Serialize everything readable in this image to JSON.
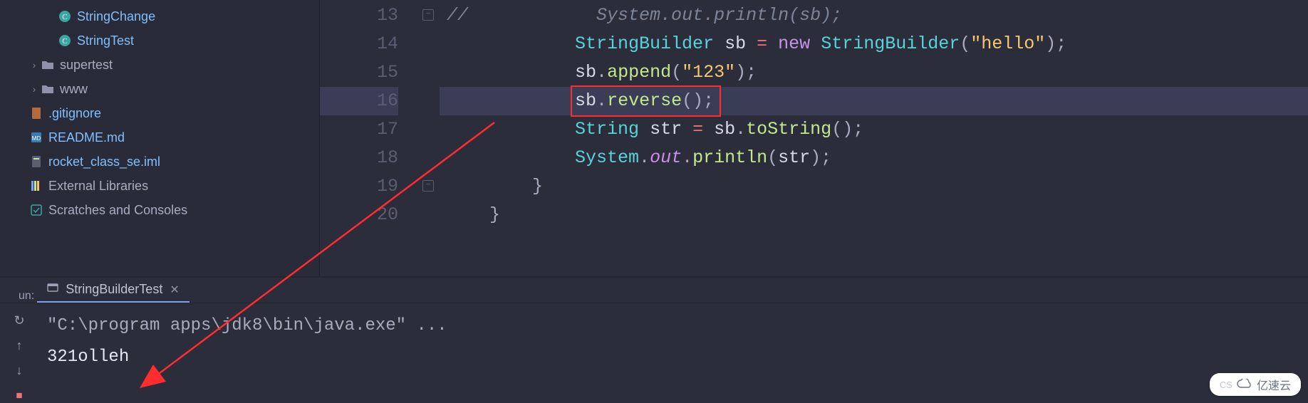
{
  "sidebar": {
    "items": [
      {
        "label": "StringChange",
        "icon": "class-circle",
        "indent": 2,
        "chev": ""
      },
      {
        "label": "StringTest",
        "icon": "class-circle",
        "indent": 2,
        "chev": ""
      },
      {
        "label": "supertest",
        "icon": "folder",
        "indent": 1,
        "chev": "›"
      },
      {
        "label": "www",
        "icon": "folder",
        "indent": 1,
        "chev": "›"
      },
      {
        "label": ".gitignore",
        "icon": "git-file",
        "indent": 0,
        "chev": ""
      },
      {
        "label": "README.md",
        "icon": "md-file",
        "indent": 0,
        "chev": ""
      },
      {
        "label": "rocket_class_se.iml",
        "icon": "iml-file",
        "indent": 0,
        "chev": ""
      },
      {
        "label": "External Libraries",
        "icon": "library",
        "indent": 0,
        "chev": ""
      },
      {
        "label": "Scratches and Consoles",
        "icon": "scratch",
        "indent": 0,
        "chev": ""
      }
    ]
  },
  "editor": {
    "lines": [
      {
        "n": "13",
        "tokens": [
          {
            "t": "//",
            "c": "c-comment"
          },
          {
            "t": "            System.out.println(sb);",
            "c": "c-comment"
          }
        ]
      },
      {
        "n": "14",
        "tokens": [
          {
            "t": "            ",
            "c": ""
          },
          {
            "t": "StringBuilder",
            "c": "c-type"
          },
          {
            "t": " ",
            "c": ""
          },
          {
            "t": "sb",
            "c": "c-ident"
          },
          {
            "t": " ",
            "c": ""
          },
          {
            "t": "=",
            "c": "c-op"
          },
          {
            "t": " ",
            "c": ""
          },
          {
            "t": "new",
            "c": "c-new"
          },
          {
            "t": " ",
            "c": ""
          },
          {
            "t": "StringBuilder",
            "c": "c-type"
          },
          {
            "t": "(",
            "c": "c-punct"
          },
          {
            "t": "\"hello\"",
            "c": "c-str"
          },
          {
            "t": ")",
            "c": "c-punct"
          },
          {
            "t": ";",
            "c": "c-punct"
          }
        ]
      },
      {
        "n": "15",
        "tokens": [
          {
            "t": "            ",
            "c": ""
          },
          {
            "t": "sb",
            "c": "c-ident"
          },
          {
            "t": ".",
            "c": "c-punct"
          },
          {
            "t": "append",
            "c": "c-method"
          },
          {
            "t": "(",
            "c": "c-punct"
          },
          {
            "t": "\"123\"",
            "c": "c-str"
          },
          {
            "t": ")",
            "c": "c-punct"
          },
          {
            "t": ";",
            "c": "c-punct"
          }
        ]
      },
      {
        "n": "16",
        "tokens": [
          {
            "t": "            ",
            "c": ""
          },
          {
            "t": "sb",
            "c": "c-ident"
          },
          {
            "t": ".",
            "c": "c-punct"
          },
          {
            "t": "reverse",
            "c": "c-method"
          },
          {
            "t": "()",
            "c": "c-punct"
          },
          {
            "t": ";",
            "c": "c-punct"
          }
        ],
        "highlight": true
      },
      {
        "n": "17",
        "tokens": [
          {
            "t": "            ",
            "c": ""
          },
          {
            "t": "String",
            "c": "c-type"
          },
          {
            "t": " ",
            "c": ""
          },
          {
            "t": "str",
            "c": "c-ident"
          },
          {
            "t": " ",
            "c": ""
          },
          {
            "t": "=",
            "c": "c-op"
          },
          {
            "t": " ",
            "c": ""
          },
          {
            "t": "sb",
            "c": "c-ident"
          },
          {
            "t": ".",
            "c": "c-punct"
          },
          {
            "t": "toString",
            "c": "c-method"
          },
          {
            "t": "()",
            "c": "c-punct"
          },
          {
            "t": ";",
            "c": "c-punct"
          }
        ]
      },
      {
        "n": "18",
        "tokens": [
          {
            "t": "            ",
            "c": ""
          },
          {
            "t": "System",
            "c": "c-type"
          },
          {
            "t": ".",
            "c": "c-punct"
          },
          {
            "t": "out",
            "c": "c-field"
          },
          {
            "t": ".",
            "c": "c-punct"
          },
          {
            "t": "println",
            "c": "c-method"
          },
          {
            "t": "(",
            "c": "c-punct"
          },
          {
            "t": "str",
            "c": "c-ident"
          },
          {
            "t": ")",
            "c": "c-punct"
          },
          {
            "t": ";",
            "c": "c-punct"
          }
        ]
      },
      {
        "n": "19",
        "tokens": [
          {
            "t": "        ",
            "c": ""
          },
          {
            "t": "}",
            "c": "c-punct"
          }
        ]
      },
      {
        "n": "20",
        "tokens": [
          {
            "t": "    ",
            "c": ""
          },
          {
            "t": "}",
            "c": "c-punct"
          }
        ]
      }
    ]
  },
  "run": {
    "tab_label": "StringBuilderTest",
    "cmd": "\"C:\\program apps\\jdk8\\bin\\java.exe\" ...",
    "output": "321olleh",
    "side_label": "un:"
  },
  "watermark": "亿速云",
  "watermark_prefix": "CS"
}
